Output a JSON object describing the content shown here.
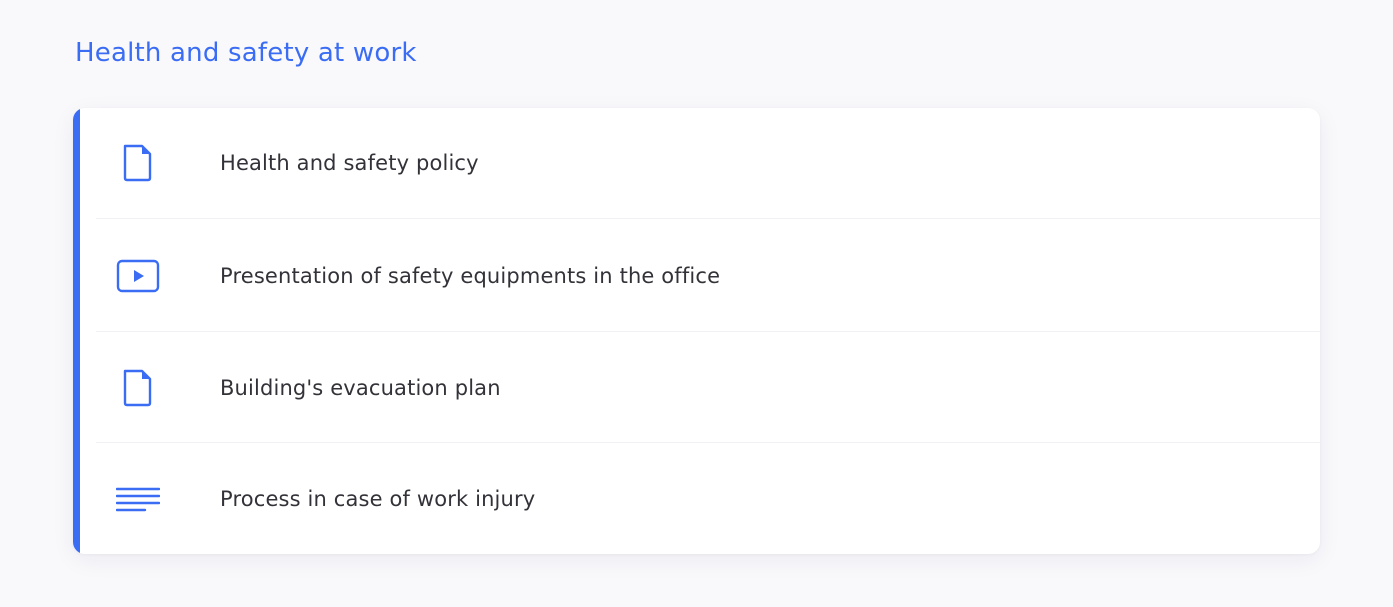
{
  "section": {
    "title": "Health and safety at work"
  },
  "items": [
    {
      "label": "Health and safety policy",
      "icon": "document-icon"
    },
    {
      "label": "Presentation of safety equipments in the office",
      "icon": "video-play-icon"
    },
    {
      "label": "Building's evacuation plan",
      "icon": "document-icon"
    },
    {
      "label": "Process in case of work injury",
      "icon": "text-lines-icon"
    }
  ],
  "colors": {
    "accent": "#3a6cf4",
    "text": "#333238",
    "background": "#f9f8fb",
    "card": "#ffffff"
  }
}
